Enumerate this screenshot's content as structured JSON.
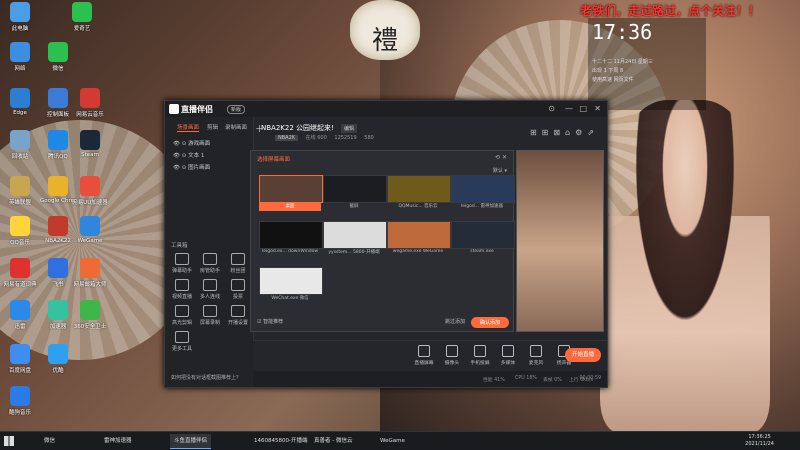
{
  "desktop": {
    "banner": "老铁们，走过路过，点个关注！！",
    "clock_time": "17:36",
    "clock_date_1": "十二十二  11月24日  星期三",
    "clock_date_2": "出现  1  下周  8",
    "clock_date_3": "使用高速  网页文件",
    "icons": [
      {
        "label": "此电脑",
        "color": "#4a9ee8"
      },
      {
        "label": "爱奇艺",
        "color": "#2bc04f"
      },
      {
        "label": "网络",
        "color": "#3b8fe0"
      },
      {
        "label": "微信",
        "color": "#2bc04f"
      },
      {
        "label": "Edge",
        "color": "#2a7fd4"
      },
      {
        "label": "控制面板",
        "color": "#3b7ad6"
      },
      {
        "label": "网易云音乐",
        "color": "#d33a31"
      },
      {
        "label": "回收站",
        "color": "#7aa3c9"
      },
      {
        "label": "腾讯QQ",
        "color": "#1e88e5"
      },
      {
        "label": "Steam",
        "color": "#1b2838"
      },
      {
        "label": "英雄联盟",
        "color": "#c8a650"
      },
      {
        "label": "Google Chrome",
        "color": "#e8b32a"
      },
      {
        "label": "网易UU加速器",
        "color": "#e94e3c"
      },
      {
        "label": "QQ音乐",
        "color": "#ffd43b"
      },
      {
        "label": "NBA2K22",
        "color": "#c0392b"
      },
      {
        "label": "WeGame",
        "color": "#2e86de"
      },
      {
        "label": "网易有道词典",
        "color": "#e03131"
      },
      {
        "label": "飞书",
        "color": "#2f6fe0"
      },
      {
        "label": "网易邮箱大师",
        "color": "#f06a35"
      },
      {
        "label": "迅雷",
        "color": "#2b8ae6"
      },
      {
        "label": "加速器",
        "color": "#35c2a0"
      },
      {
        "label": "360安全卫士",
        "color": "#3fb64a"
      },
      {
        "label": "百度网盘",
        "color": "#3d8ef0"
      },
      {
        "label": "优酷",
        "color": "#2fa0f0"
      },
      {
        "label": "酷狗音乐",
        "color": "#2b7ae6"
      }
    ]
  },
  "app": {
    "title": "直播伴侣",
    "version_badge": "新版",
    "window_controls": [
      "⊙",
      "—",
      "□",
      "✕"
    ],
    "left_tabs": [
      "场景画面",
      "剪辑",
      "录制画面"
    ],
    "scenes": [
      "游戏画面",
      "文本 1",
      "图片画面"
    ],
    "tools_title": "工具箱",
    "tools": [
      "弹幕助手",
      "房管助手",
      "粉丝团",
      "视频直播",
      "多人连线",
      "投票",
      "高光剪辑",
      "屏幕录制",
      "开播设置",
      "更多工具"
    ],
    "tip": "如何把没有对话框截图推荐上？",
    "game_title": "NBA2K22 公园继起来!",
    "edit_badge": "编辑",
    "tags": {
      "game": "NBA2K",
      "viewers": "在线 600",
      "likes": "1252519",
      "fans": "580"
    },
    "right_icons": [
      "⊞",
      "⊞",
      "⊠",
      "⌂",
      "⚙",
      "⇗"
    ]
  },
  "dialog": {
    "title": "选择屏幕画面",
    "sort_label": "默认 ▾",
    "sources": [
      {
        "caption": "桌面",
        "selected": true,
        "thumb": "#5a4034"
      },
      {
        "caption": "截屏",
        "selected": false,
        "thumb": "#1c1d20"
      },
      {
        "caption": "QQMusic... 音乐云",
        "selected": false,
        "thumb": "#6e5a1a"
      },
      {
        "caption": "leigod... 雷神加速器",
        "selected": false,
        "thumb": "#2a3a5a"
      },
      {
        "caption": "leigod.ex... downWindow",
        "selected": false,
        "thumb": "#111"
      },
      {
        "caption": "yysstem... 5800-开播端",
        "selected": false,
        "thumb": "#dcdcdc"
      },
      {
        "caption": "wegame.exe   WeGame",
        "selected": false,
        "thumb": "#c0693a"
      },
      {
        "caption": "steam.exe",
        "selected": false,
        "thumb": "#222b36"
      },
      {
        "caption": "WeChat.exe   微信",
        "selected": false,
        "thumb": "#e8e8e8"
      }
    ],
    "footer_checkbox": "智能推荐",
    "cancel": "跳过添加",
    "confirm": "确认添加"
  },
  "bottombar": {
    "tools": [
      "直播屏幕",
      "摄像头",
      "手机投屏",
      "多媒体",
      "麦克风",
      "扬声器"
    ],
    "live_button": "开始直播",
    "status": [
      "性能 41%",
      "CPU 18%",
      "丢帧 0%",
      "上行 0kb/s",
      "00:00:59"
    ]
  },
  "taskbar": {
    "items": [
      {
        "label": "微信",
        "active": false
      },
      {
        "label": "雷神加速器",
        "active": false
      },
      {
        "label": "斗鱼直播伴侣",
        "active": true
      },
      {
        "label": "1460845800-开播端",
        "active": false
      },
      {
        "label": "真善者 - 微信云",
        "active": false
      },
      {
        "label": "WeGame",
        "active": false
      }
    ],
    "tray_time": "17:36:25",
    "tray_date": "2021/11/24"
  }
}
